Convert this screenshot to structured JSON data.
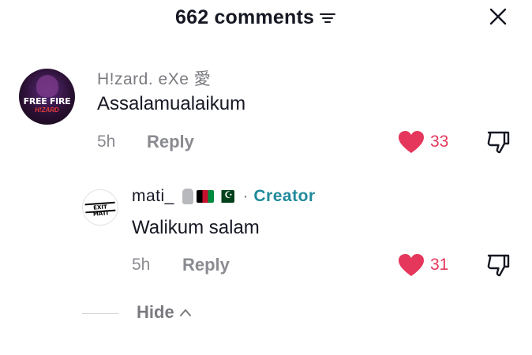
{
  "header": {
    "title": "662 comments"
  },
  "comments": [
    {
      "username": "H!zard. eXe 愛",
      "avatar_text": "FREE FIRE",
      "avatar_sub": "H!ZARD",
      "text": "Assalamualaikum",
      "time": "5h",
      "reply_label": "Reply",
      "likes": "33"
    }
  ],
  "replies": [
    {
      "username": "mati_",
      "avatar_text": "EXIT MATI",
      "creator_sep": "·",
      "creator_label": "Creator",
      "text": "Walikum salam",
      "time": "5h",
      "reply_label": "Reply",
      "likes": "31"
    }
  ],
  "hide_label": "Hide",
  "colors": {
    "like_red": "#e5375c",
    "creator_teal": "#1f8a9b",
    "muted_gray": "#8a8b91"
  }
}
